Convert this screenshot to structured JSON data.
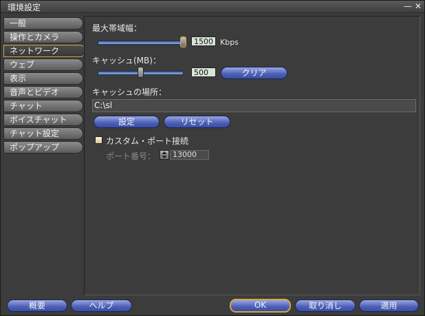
{
  "window": {
    "title": "環境設定",
    "minimize_glyph": "—",
    "close_glyph": "✕"
  },
  "sidebar": {
    "items": [
      {
        "label": "一般"
      },
      {
        "label": "操作とカメラ"
      },
      {
        "label": "ネットワーク",
        "active": true
      },
      {
        "label": "ウェブ"
      },
      {
        "label": "表示"
      },
      {
        "label": "音声とビデオ"
      },
      {
        "label": "チャット"
      },
      {
        "label": "ボイスチャット"
      },
      {
        "label": "チャット設定"
      },
      {
        "label": "ポップアップ"
      }
    ]
  },
  "network": {
    "bandwidth_label": "最大帯域幅：",
    "bandwidth_value": "1500",
    "bandwidth_unit": "Kbps",
    "bandwidth_level": 1.0,
    "cache_label": "キャッシュ(MB)：",
    "cache_value": "500",
    "cache_level": 0.5,
    "clear_button": "クリア",
    "cache_location_label": "キャッシュの場所：",
    "cache_path": "C:\\sl",
    "set_button": "設定",
    "reset_button": "リセット",
    "custom_port_label": "カスタム・ポート接続",
    "custom_port_checked": false,
    "port_label": "ポート番号：",
    "port_value": "13000"
  },
  "footer": {
    "about_button": "概要",
    "help_button": "ヘルプ",
    "ok_button": "OK",
    "cancel_button": "取り消し",
    "apply_button": "適用"
  },
  "colors": {
    "accent_border": "#d9a640",
    "button_blue": "#4b5fb6",
    "panel_bg": "#3c3c3c"
  }
}
